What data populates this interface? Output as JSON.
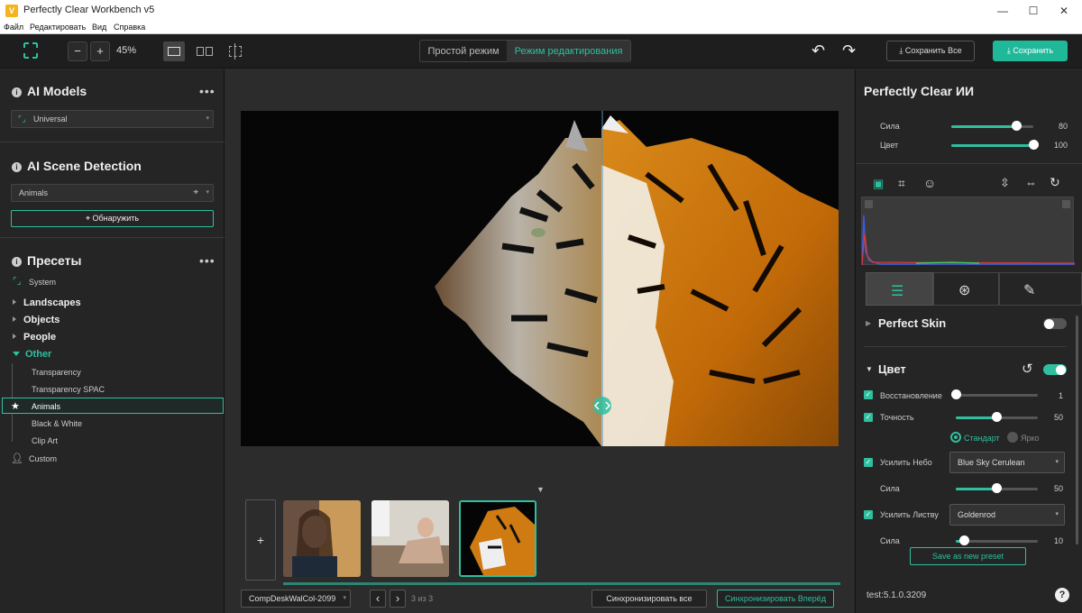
{
  "window": {
    "title": "Perfectly Clear Workbench v5",
    "app_icon": "V",
    "min": "—",
    "max": "☐",
    "close": "✕"
  },
  "menu": [
    "Файл",
    "Редактировать",
    "Вид",
    "Справка"
  ],
  "toolbar": {
    "zoom_minus": "−",
    "zoom_plus": "+",
    "zoom": "45%",
    "mode_simple": "Простой режим",
    "mode_edit": "Режим редактирования",
    "save_all": "Сохранить Все",
    "save": "Сохранить",
    "undo": "↶",
    "redo": "↷"
  },
  "left": {
    "ai_models": {
      "title": "AI Models",
      "value": "Universal",
      "menu": "•••"
    },
    "scene": {
      "title": "AI Scene Detection",
      "value": "Animals",
      "detect": "Обнаружить",
      "menu": "•••"
    },
    "presets": {
      "title": "Пресеты",
      "menu": "•••",
      "system": "System",
      "categories": [
        "Landscapes",
        "Objects",
        "People"
      ],
      "other": "Other",
      "items": [
        "Transparency",
        "Transparency SPAC",
        "Animals",
        "Black & White",
        "Clip Art"
      ],
      "custom": "Custom"
    }
  },
  "bottom": {
    "add": "+",
    "file": "CompDeskWalCol-2099",
    "prev": "‹",
    "next": "›",
    "counter": "3 из 3",
    "sync_all": "Синхронизировать все",
    "sync_forward": "Синхронизировать Вперёд"
  },
  "right": {
    "title": "Perfectly Clear ИИ",
    "strength_label": "Сила",
    "strength": 80,
    "strength_text": "80",
    "color_label": "Цвет",
    "color": 100,
    "color_text": "100",
    "perfect_skin": "Perfect Skin",
    "color_section": "Цвет",
    "restore_label": "Восстановление",
    "restore": 1,
    "restore_text": "1",
    "accuracy_label": "Точность",
    "accuracy": 50,
    "accuracy_text": "50",
    "radio_standard": "Стандарт",
    "radio_bright": "Ярко",
    "sky_label": "Усилить Небо",
    "sky_value": "Blue Sky Cerulean",
    "sky_strength_label": "Сила",
    "sky_strength": 50,
    "sky_strength_text": "50",
    "foliage_label": "Усилить Листву",
    "foliage_value": "Goldenrod",
    "foliage_strength_label": "Сила",
    "foliage_strength": 10,
    "foliage_strength_text": "10",
    "save_preset": "Save as new preset",
    "version": "test:5.1.0.3209",
    "help": "?"
  },
  "colors": {
    "accent": "#2fbf9f",
    "save_btn": "#1fb99a"
  }
}
